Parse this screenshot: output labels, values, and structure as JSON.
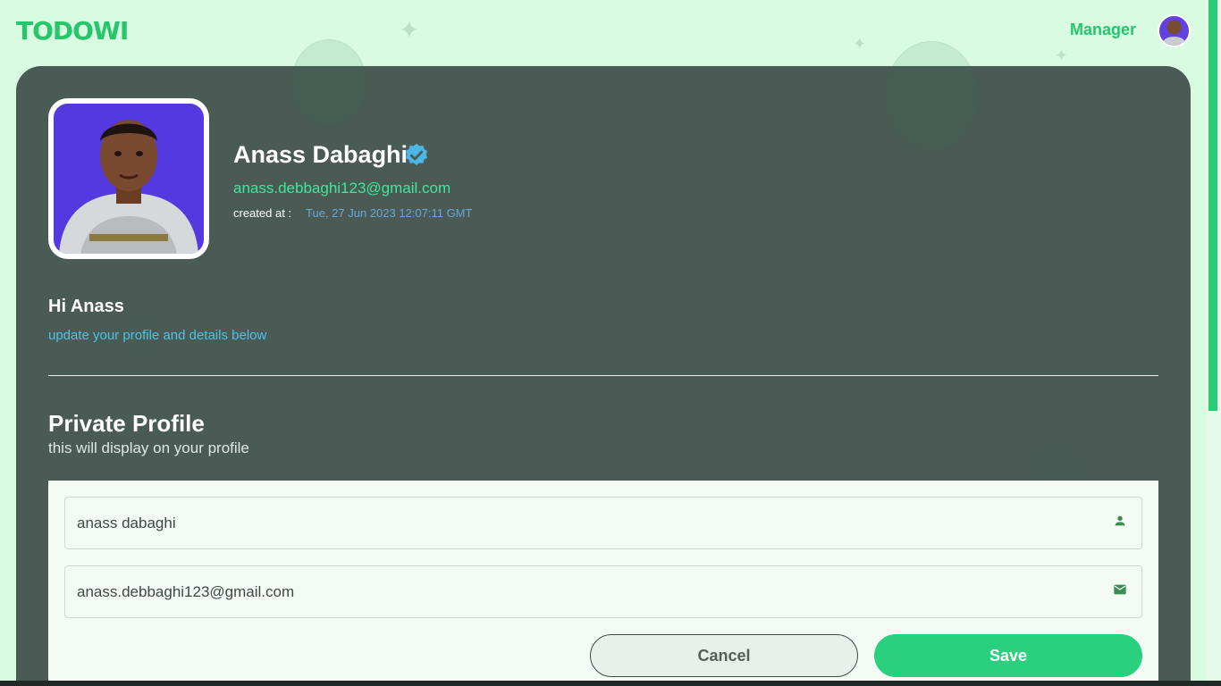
{
  "app": {
    "logo": "TODOWI"
  },
  "nav": {
    "role": "Manager",
    "avatar_icon": "user-avatar"
  },
  "profile": {
    "name": "Anass Dabaghi",
    "verified_icon": "verified-badge-icon",
    "email": "anass.debbaghi123@gmail.com",
    "created_label": "created at :",
    "created_value": "Tue, 27 Jun 2023 12:07:11 GMT"
  },
  "greeting": {
    "title": "Hi Anass",
    "subtitle": "update your profile and details below"
  },
  "section": {
    "title": "Private Profile",
    "subtitle": "this will display on your profile"
  },
  "form": {
    "name_value": "anass dabaghi",
    "name_icon": "person-icon",
    "email_value": "anass.debbaghi123@gmail.com",
    "email_icon": "mail-icon",
    "cancel_label": "Cancel",
    "save_label": "Save"
  },
  "colors": {
    "accent": "#25c76a",
    "background": "#d9fbe1",
    "panel": "#4d5b57",
    "email_text": "#3ee89a",
    "link_text": "#4cc3e6"
  }
}
